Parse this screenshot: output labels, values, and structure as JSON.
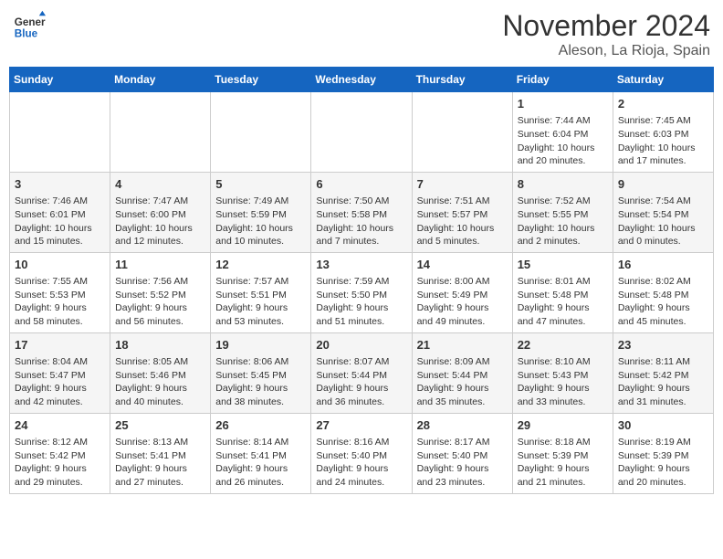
{
  "header": {
    "logo_line1": "General",
    "logo_line2": "Blue",
    "month": "November 2024",
    "location": "Aleson, La Rioja, Spain"
  },
  "weekdays": [
    "Sunday",
    "Monday",
    "Tuesday",
    "Wednesday",
    "Thursday",
    "Friday",
    "Saturday"
  ],
  "weeks": [
    [
      {
        "day": "",
        "info": ""
      },
      {
        "day": "",
        "info": ""
      },
      {
        "day": "",
        "info": ""
      },
      {
        "day": "",
        "info": ""
      },
      {
        "day": "",
        "info": ""
      },
      {
        "day": "1",
        "info": "Sunrise: 7:44 AM\nSunset: 6:04 PM\nDaylight: 10 hours and 20 minutes."
      },
      {
        "day": "2",
        "info": "Sunrise: 7:45 AM\nSunset: 6:03 PM\nDaylight: 10 hours and 17 minutes."
      }
    ],
    [
      {
        "day": "3",
        "info": "Sunrise: 7:46 AM\nSunset: 6:01 PM\nDaylight: 10 hours and 15 minutes."
      },
      {
        "day": "4",
        "info": "Sunrise: 7:47 AM\nSunset: 6:00 PM\nDaylight: 10 hours and 12 minutes."
      },
      {
        "day": "5",
        "info": "Sunrise: 7:49 AM\nSunset: 5:59 PM\nDaylight: 10 hours and 10 minutes."
      },
      {
        "day": "6",
        "info": "Sunrise: 7:50 AM\nSunset: 5:58 PM\nDaylight: 10 hours and 7 minutes."
      },
      {
        "day": "7",
        "info": "Sunrise: 7:51 AM\nSunset: 5:57 PM\nDaylight: 10 hours and 5 minutes."
      },
      {
        "day": "8",
        "info": "Sunrise: 7:52 AM\nSunset: 5:55 PM\nDaylight: 10 hours and 2 minutes."
      },
      {
        "day": "9",
        "info": "Sunrise: 7:54 AM\nSunset: 5:54 PM\nDaylight: 10 hours and 0 minutes."
      }
    ],
    [
      {
        "day": "10",
        "info": "Sunrise: 7:55 AM\nSunset: 5:53 PM\nDaylight: 9 hours and 58 minutes."
      },
      {
        "day": "11",
        "info": "Sunrise: 7:56 AM\nSunset: 5:52 PM\nDaylight: 9 hours and 56 minutes."
      },
      {
        "day": "12",
        "info": "Sunrise: 7:57 AM\nSunset: 5:51 PM\nDaylight: 9 hours and 53 minutes."
      },
      {
        "day": "13",
        "info": "Sunrise: 7:59 AM\nSunset: 5:50 PM\nDaylight: 9 hours and 51 minutes."
      },
      {
        "day": "14",
        "info": "Sunrise: 8:00 AM\nSunset: 5:49 PM\nDaylight: 9 hours and 49 minutes."
      },
      {
        "day": "15",
        "info": "Sunrise: 8:01 AM\nSunset: 5:48 PM\nDaylight: 9 hours and 47 minutes."
      },
      {
        "day": "16",
        "info": "Sunrise: 8:02 AM\nSunset: 5:48 PM\nDaylight: 9 hours and 45 minutes."
      }
    ],
    [
      {
        "day": "17",
        "info": "Sunrise: 8:04 AM\nSunset: 5:47 PM\nDaylight: 9 hours and 42 minutes."
      },
      {
        "day": "18",
        "info": "Sunrise: 8:05 AM\nSunset: 5:46 PM\nDaylight: 9 hours and 40 minutes."
      },
      {
        "day": "19",
        "info": "Sunrise: 8:06 AM\nSunset: 5:45 PM\nDaylight: 9 hours and 38 minutes."
      },
      {
        "day": "20",
        "info": "Sunrise: 8:07 AM\nSunset: 5:44 PM\nDaylight: 9 hours and 36 minutes."
      },
      {
        "day": "21",
        "info": "Sunrise: 8:09 AM\nSunset: 5:44 PM\nDaylight: 9 hours and 35 minutes."
      },
      {
        "day": "22",
        "info": "Sunrise: 8:10 AM\nSunset: 5:43 PM\nDaylight: 9 hours and 33 minutes."
      },
      {
        "day": "23",
        "info": "Sunrise: 8:11 AM\nSunset: 5:42 PM\nDaylight: 9 hours and 31 minutes."
      }
    ],
    [
      {
        "day": "24",
        "info": "Sunrise: 8:12 AM\nSunset: 5:42 PM\nDaylight: 9 hours and 29 minutes."
      },
      {
        "day": "25",
        "info": "Sunrise: 8:13 AM\nSunset: 5:41 PM\nDaylight: 9 hours and 27 minutes."
      },
      {
        "day": "26",
        "info": "Sunrise: 8:14 AM\nSunset: 5:41 PM\nDaylight: 9 hours and 26 minutes."
      },
      {
        "day": "27",
        "info": "Sunrise: 8:16 AM\nSunset: 5:40 PM\nDaylight: 9 hours and 24 minutes."
      },
      {
        "day": "28",
        "info": "Sunrise: 8:17 AM\nSunset: 5:40 PM\nDaylight: 9 hours and 23 minutes."
      },
      {
        "day": "29",
        "info": "Sunrise: 8:18 AM\nSunset: 5:39 PM\nDaylight: 9 hours and 21 minutes."
      },
      {
        "day": "30",
        "info": "Sunrise: 8:19 AM\nSunset: 5:39 PM\nDaylight: 9 hours and 20 minutes."
      }
    ]
  ]
}
